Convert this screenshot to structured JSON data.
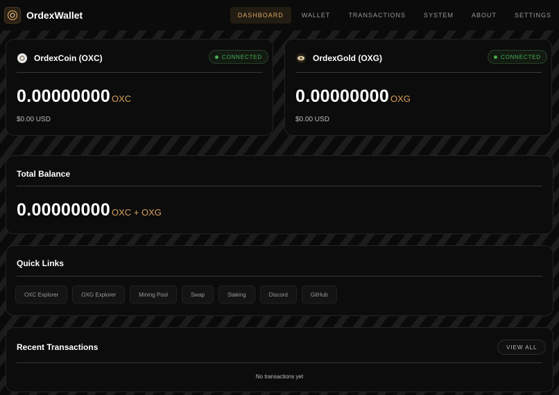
{
  "app": {
    "name": "OrdexWallet"
  },
  "nav": {
    "items": [
      "DASHBOARD",
      "WALLET",
      "TRANSACTIONS",
      "SYSTEM",
      "ABOUT",
      "SETTINGS"
    ],
    "active_index": 0
  },
  "coins": [
    {
      "name": "OrdexCoin (OXC)",
      "status": "CONNECTED",
      "balance": "0.00000000",
      "unit": "OXC",
      "usd": "$0.00 USD",
      "icon": "oxc-coin-icon"
    },
    {
      "name": "OrdexGold (OXG)",
      "status": "CONNECTED",
      "balance": "0.00000000",
      "unit": "OXG",
      "usd": "$0.00 USD",
      "icon": "oxg-eye-icon"
    }
  ],
  "total": {
    "title": "Total Balance",
    "balance": "0.00000000",
    "unit": "OXC + OXG"
  },
  "quick_links": {
    "title": "Quick Links",
    "items": [
      "OXC Explorer",
      "OXG Explorer",
      "Mining Pool",
      "Swap",
      "Staking",
      "Discord",
      "GitHub"
    ]
  },
  "transactions": {
    "title": "Recent Transactions",
    "view_all": "VIEW ALL",
    "empty": "No transactions yet"
  },
  "colors": {
    "accent": "#d9a05c",
    "connected": "#4caf50",
    "active_nav_bg": "#221c12"
  }
}
